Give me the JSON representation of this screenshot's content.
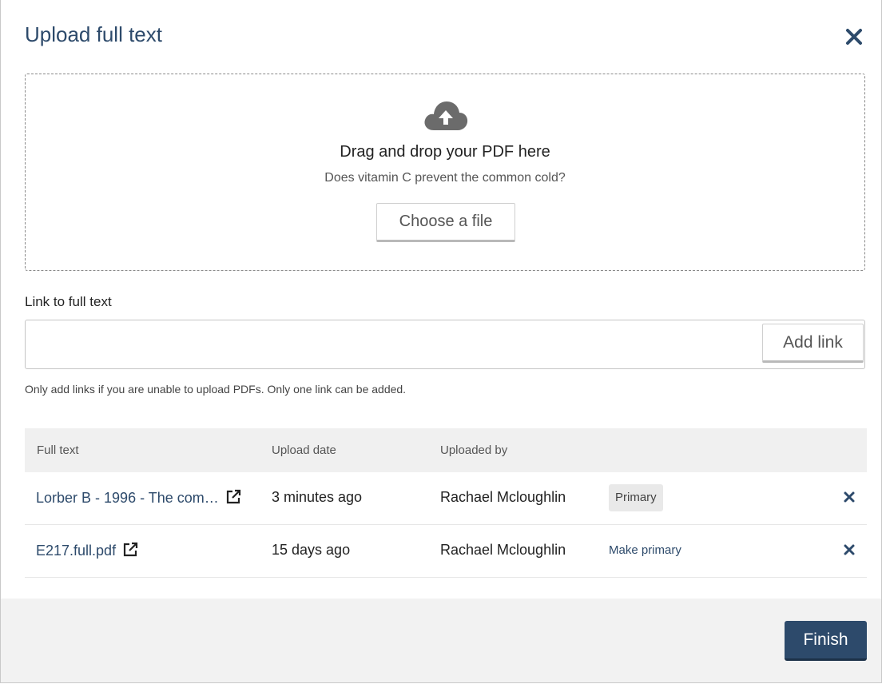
{
  "modal": {
    "title": "Upload full text"
  },
  "dropzone": {
    "title": "Drag and drop your PDF here",
    "subtitle": "Does vitamin C prevent the common cold?",
    "choose_button": "Choose a file"
  },
  "link": {
    "label": "Link to full text",
    "value": "",
    "add_button": "Add link",
    "hint": "Only add links if you are unable to upload PDFs. Only one link can be added."
  },
  "table": {
    "headers": [
      "Full text",
      "Upload date",
      "Uploaded by"
    ],
    "rows": [
      {
        "file": "Lorber B - 1996 - The com…",
        "date": "3 minutes ago",
        "uploader": "Rachael Mcloughlin",
        "status": "Primary"
      },
      {
        "file": "E217.full.pdf",
        "date": "15 days ago",
        "uploader": "Rachael Mcloughlin",
        "action": "Make primary"
      }
    ]
  },
  "footer": {
    "finish_button": "Finish"
  },
  "colors": {
    "accent": "#2d4a6b",
    "footer_bg": "#f2f2f2"
  }
}
